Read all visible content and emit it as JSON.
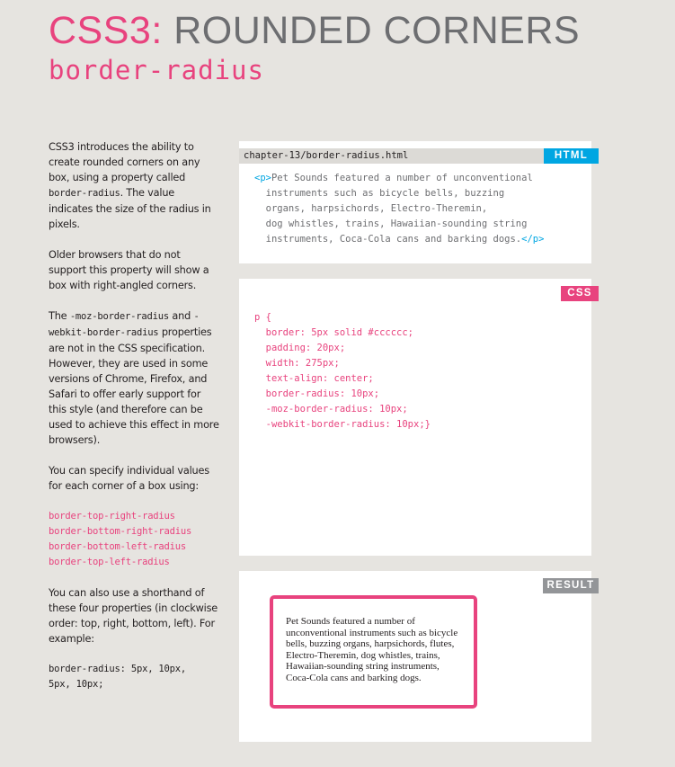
{
  "heading": {
    "prefix": "CSS3:",
    "title": "ROUNDED CORNERS",
    "subtitle": "border-radius"
  },
  "sidebar": {
    "p1": {
      "a": "CSS3 introduces the ability to create rounded corners on any box, using a property called ",
      "code": "border-radius",
      "b": ". The value indicates the size of the radius in pixels."
    },
    "p2": "Older browsers that do not support this property will show a box with right-angled corners.",
    "p3": {
      "a": "The ",
      "code1": "-moz-border-radius",
      "mid": " and ",
      "code2": "-webkit-border-radius",
      "b": " properties are not in the CSS specification. However, they are used in some versions of Chrome, Firefox, and Safari to offer early support for this style (and therefore can be used to achieve this effect in more browsers)."
    },
    "p4": "You can specify individual values for each corner of a box using:",
    "corner_props": [
      "border-top-right-radius",
      "border-bottom-right-radius",
      "border-bottom-left-radius",
      "border-top-left-radius"
    ],
    "p5": "You can also use a shorthand of these four properties (in clockwise order: top, right, bottom, left). For example:",
    "example_lines": [
      "border-radius: 5px, 10px,",
      "5px, 10px;"
    ]
  },
  "html_panel": {
    "file": "chapter-13/border-radius.html",
    "tag": "HTML",
    "open_tag": "<p>",
    "close_tag": "</p>",
    "lines": [
      "Pet Sounds featured a number of unconventional",
      "  instruments such as bicycle bells, buzzing",
      "  organs, harpsichords, Electro-Theremin,",
      "  dog whistles, trains, Hawaiian-sounding string",
      "  instruments, Coca-Cola cans and barking dogs."
    ]
  },
  "css_panel": {
    "tag": "CSS",
    "lines": [
      "p {",
      "  border: 5px solid #cccccc;",
      "  padding: 20px;",
      "  width: 275px;",
      "  text-align: center;",
      "  border-radius: 10px;",
      "  -moz-border-radius: 10px;",
      "  -webkit-border-radius: 10px;}"
    ]
  },
  "result_panel": {
    "tag": "RESULT",
    "text": "Pet Sounds featured a number of unconventional instruments such as bicycle bells, buzzing organs, harpsichords, flutes, Electro-Theremin, dog whistles, trains, Hawaiian-sounding string instruments, Coca-Cola cans and barking dogs."
  }
}
